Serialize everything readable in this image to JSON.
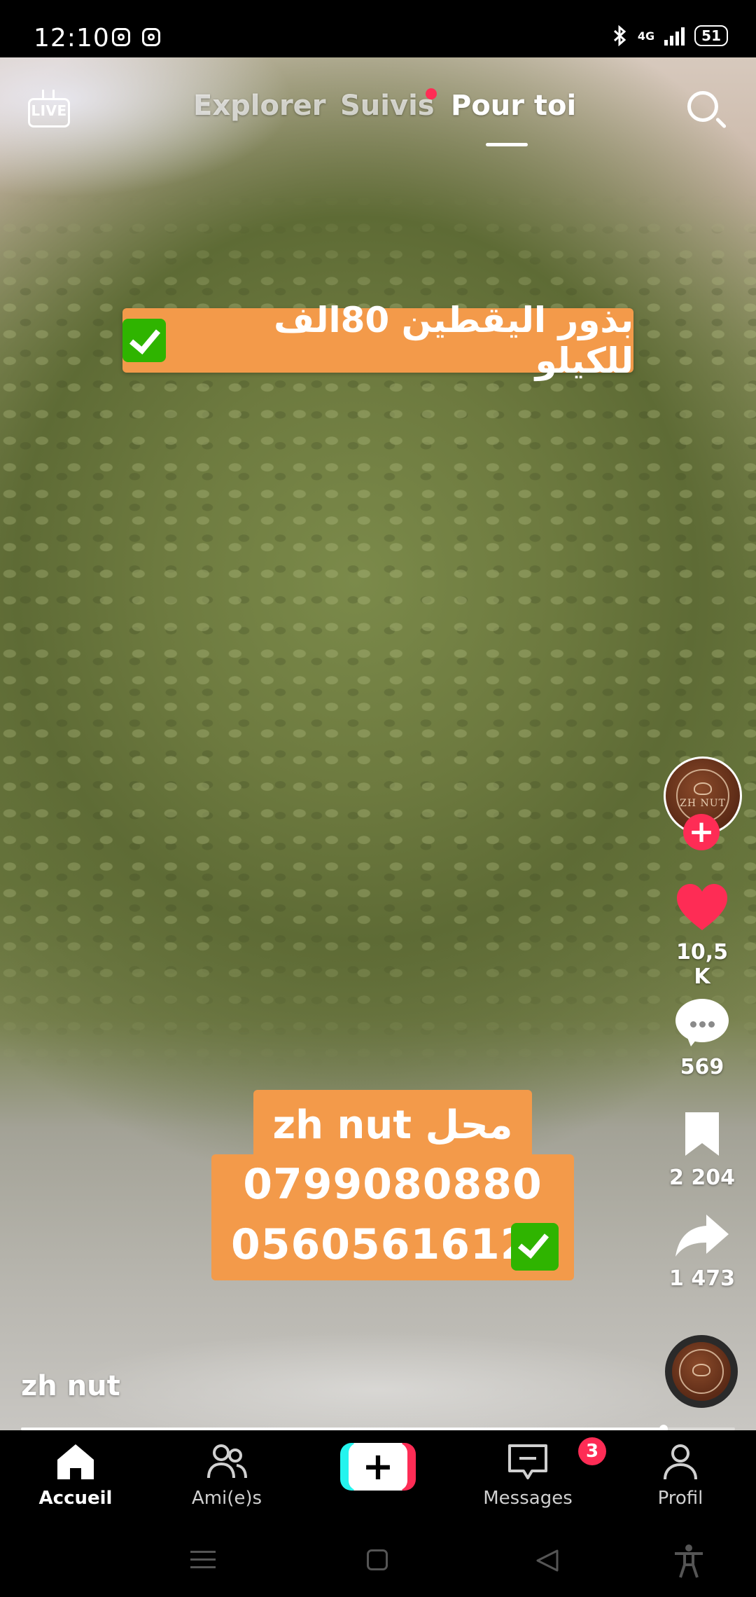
{
  "status_bar": {
    "time": "12:10",
    "network": "4G",
    "battery": "51",
    "icons": [
      "instagram-icon",
      "instagram-icon",
      "bluetooth-icon",
      "signal-icon",
      "battery-icon"
    ]
  },
  "top_nav": {
    "live_label": "LIVE",
    "tabs": [
      {
        "label": "Explorer",
        "active": false
      },
      {
        "label": "Suivis",
        "active": false,
        "has_dot": true
      },
      {
        "label": "Pour toi",
        "active": true
      }
    ],
    "search_icon": "search-icon"
  },
  "video": {
    "overlay_title": "بذور اليقطين 80الف للكيلو",
    "overlay_shop": "zh nut محل",
    "phone_1": "0799080880",
    "phone_2": "0560561612",
    "progress": 0.9
  },
  "author": {
    "username": "zh nut",
    "avatar_text": "ZH NUT"
  },
  "actions": {
    "likes": "10,5 K",
    "comments": "569",
    "saves": "2 204",
    "shares": "1 473"
  },
  "bottom_nav": {
    "items": [
      {
        "label": "Accueil",
        "icon": "home-icon",
        "active": true
      },
      {
        "label": "Ami(e)s",
        "icon": "friends-icon",
        "active": false
      },
      {
        "label": "+",
        "icon": "create-icon",
        "active": false
      },
      {
        "label": "Messages",
        "icon": "inbox-icon",
        "active": false,
        "badge": "3"
      },
      {
        "label": "Profil",
        "icon": "profile-icon",
        "active": false
      }
    ]
  },
  "colors": {
    "accent_red": "#fe2c55",
    "overlay_orange": "#f39a4a",
    "check_green": "#2fb400"
  }
}
